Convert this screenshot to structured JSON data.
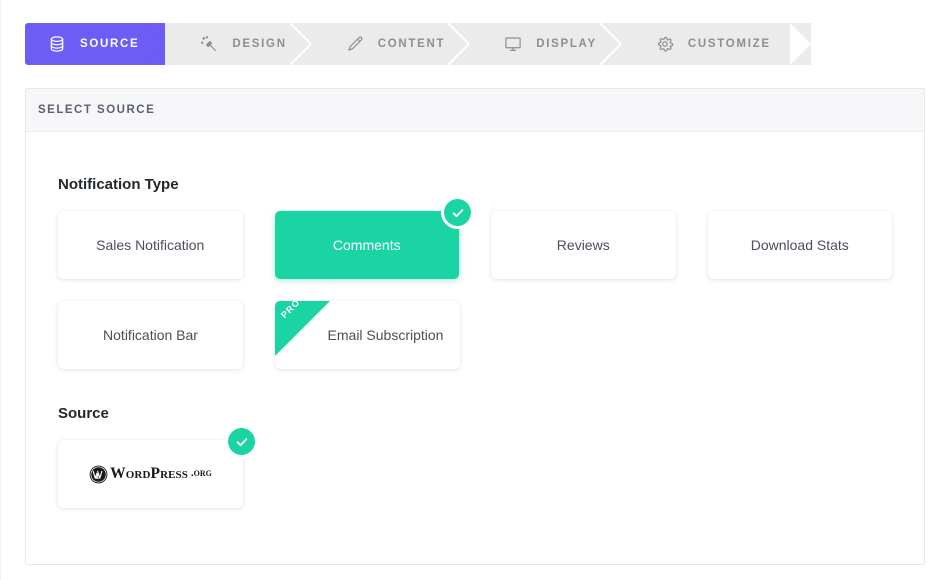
{
  "steps": [
    {
      "label": "SOURCE",
      "icon": "database-icon",
      "active": true
    },
    {
      "label": "DESIGN",
      "icon": "magic-wand-icon",
      "active": false
    },
    {
      "label": "CONTENT",
      "icon": "pencil-icon",
      "active": false
    },
    {
      "label": "DISPLAY",
      "icon": "monitor-icon",
      "active": false
    },
    {
      "label": "CUSTOMIZE",
      "icon": "gear-icon",
      "active": false
    }
  ],
  "panel": {
    "header_title": "SELECT SOURCE"
  },
  "notification_type": {
    "heading": "Notification Type",
    "cards": [
      {
        "label": "Sales Notification",
        "selected": false,
        "pro": false
      },
      {
        "label": "Comments",
        "selected": true,
        "pro": false
      },
      {
        "label": "Reviews",
        "selected": false,
        "pro": false
      },
      {
        "label": "Download Stats",
        "selected": false,
        "pro": false
      },
      {
        "label": "Notification Bar",
        "selected": false,
        "pro": false
      },
      {
        "label": "Email Subscription",
        "selected": false,
        "pro": true
      }
    ],
    "pro_badge_label": "PRO"
  },
  "source": {
    "heading": "Source",
    "cards": [
      {
        "logo": "wordpress-org-logo",
        "word": "ORD",
        "word_cap": "W",
        "press": "RESS",
        "press_cap": "P",
        "org": "ORG",
        "org_dot": ".",
        "selected": true
      }
    ]
  },
  "colors": {
    "accent_purple": "#6d5df6",
    "accent_green": "#1ad4a4",
    "tab_inactive_bg": "#ebebeb",
    "panel_header_bg": "#f7f7f9"
  }
}
